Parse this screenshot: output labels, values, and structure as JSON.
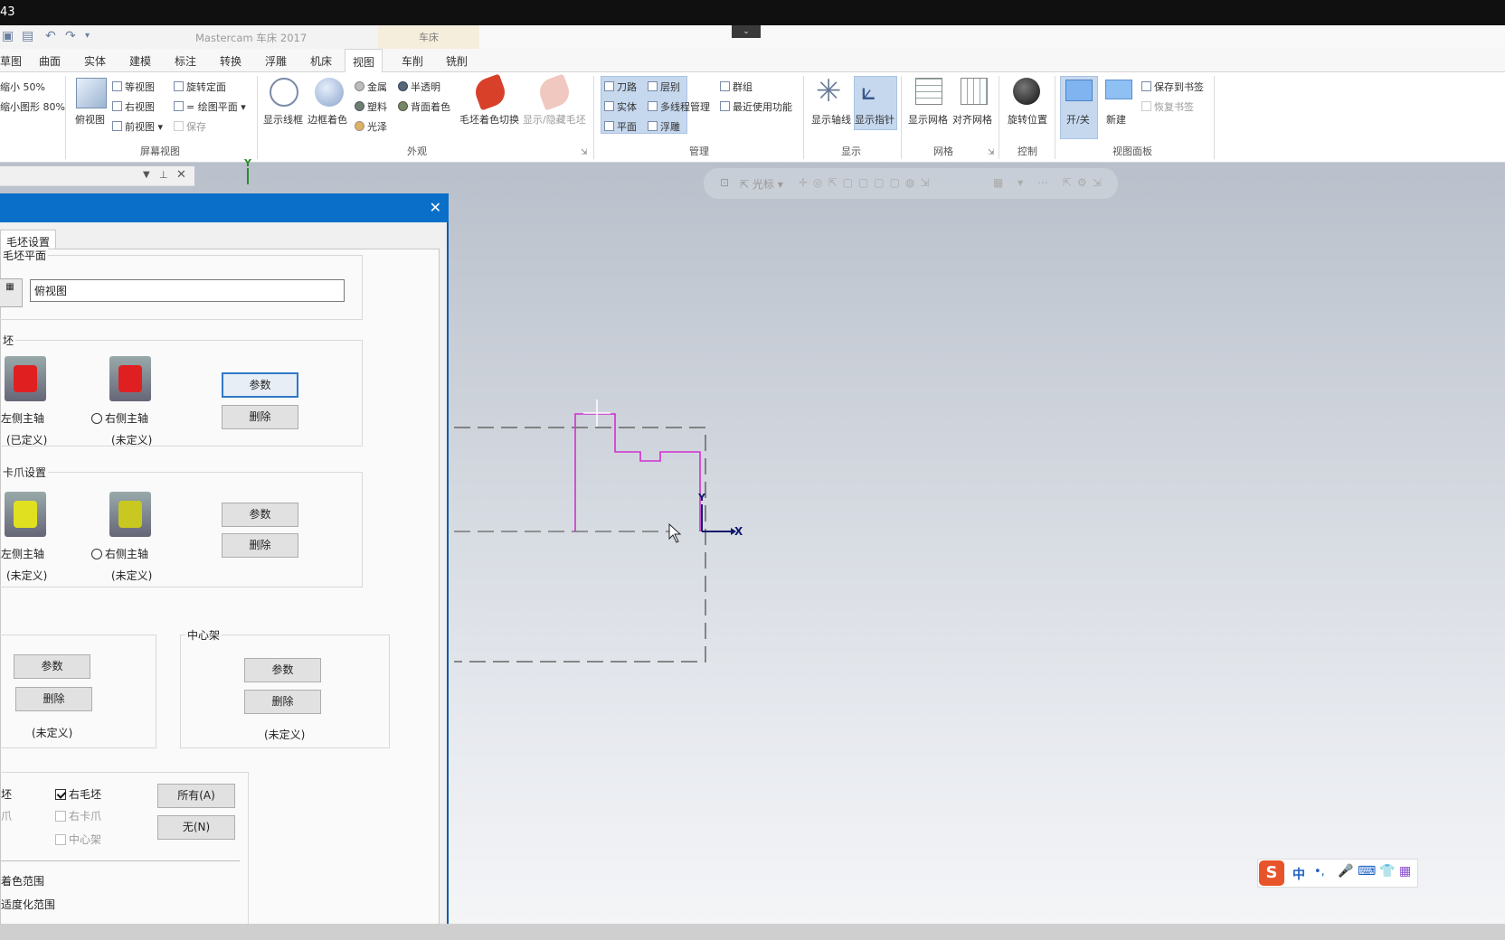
{
  "window": {
    "title_fragment": "43",
    "app_title": "Mastercam 车床 2017",
    "context_tab": "车床"
  },
  "tabs": [
    "草图",
    "曲面",
    "实体",
    "建模",
    "标注",
    "转换",
    "浮雕",
    "机床",
    "视图",
    "车削",
    "铣削"
  ],
  "active_tab": "视图",
  "ribbon": {
    "zoom": {
      "a": "缩小 50%",
      "b": "缩小图形 80%"
    },
    "screen_view": {
      "top": "俯视图",
      "iso": "等视图",
      "right": "右视图",
      "front": "前视图",
      "rotate": "旋转定面",
      "equal_plane": "= 绘图平面",
      "save": "保存",
      "group": "屏幕视图"
    },
    "appearance": {
      "wire": "显示线框",
      "edge": "边框着色",
      "metal": "金属",
      "plastic": "塑料",
      "matte": "光泽",
      "translucent": "半透明",
      "backface": "背面着色",
      "stock_shade": "毛坯着色切换",
      "show_hide_stock": "显示/隐藏毛坯",
      "group": "外观"
    },
    "manage": {
      "toolpath": "刀路",
      "level": "层别",
      "solid": "实体",
      "multithread": "多线程管理",
      "plane": "平面",
      "float": "浮雕",
      "groups": "群组",
      "recent": "最近使用功能",
      "group": "管理"
    },
    "display": {
      "axes": "显示轴线",
      "gnomon": "显示指针",
      "group": "显示"
    },
    "grid": {
      "show": "显示网格",
      "snap": "对齐网格",
      "group": "网格"
    },
    "control": {
      "spin": "旋转位置",
      "group": "控制"
    },
    "viewsheet": {
      "onoff": "开/关",
      "new": "新建",
      "bookmark": "保存到书签",
      "restore": "恢复书签",
      "group": "视图面板"
    }
  },
  "viewbar": {
    "cursor": "光标"
  },
  "dialog": {
    "tab": "毛坯设置",
    "plane_group": "毛坯平面",
    "plane_value": "俯视图",
    "stock_group": "毛坯",
    "chuck_group": "卡爪设置",
    "steady_group": "中心架",
    "left_spindle": "左侧主轴",
    "right_spindle": "右侧主轴",
    "defined": "(已定义)",
    "undefined": "(未定义)",
    "params": "参数",
    "delete": "删除",
    "right_stock": "右毛坯",
    "right_chuck": "右卡爪",
    "steady_chk": "中心架",
    "all_btn": "所有(A)",
    "none_btn": "无(N)",
    "shade_range": "着色范围",
    "adapt_range": "适度化范围",
    "frag_stock": "坯",
    "frag_chuck": "爪"
  },
  "canvas": {
    "x_label": "X",
    "y_label": "Y"
  },
  "ime": {
    "zh": "中",
    "punct": "•,"
  },
  "colors": {
    "accent": "#0a6fc9",
    "magenta": "#d030d0"
  }
}
